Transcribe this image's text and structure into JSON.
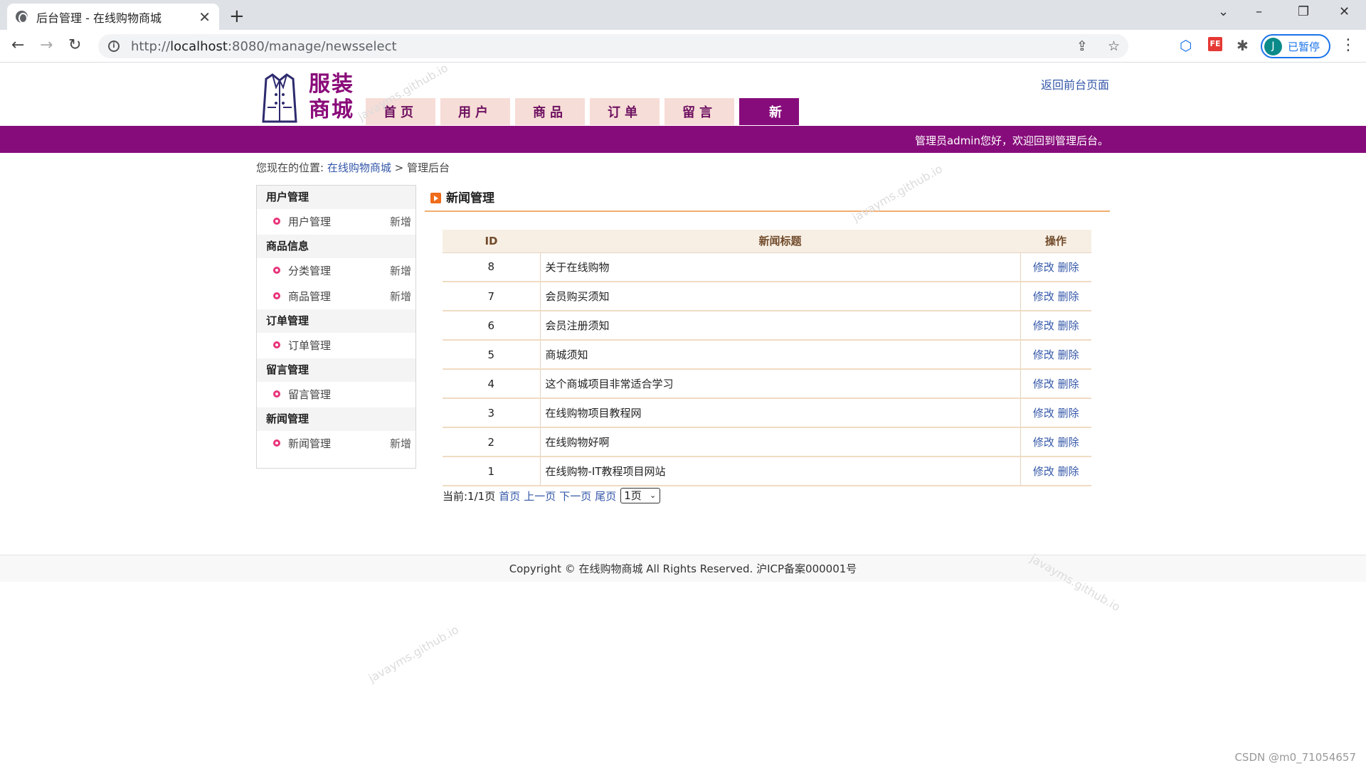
{
  "browser": {
    "tab_title": "后台管理 - 在线购物商城",
    "tab_close": "✕",
    "new_tab": "+",
    "url_proto": "http://",
    "url_host": "localhost",
    "url_rest": ":8080/manage/newsselect",
    "profile_initial": "J",
    "profile_label": "已暂停"
  },
  "header": {
    "logo_text": "服装商城",
    "back_link": "返回前台页面",
    "nav_tabs": [
      "首页",
      "用户",
      "商品",
      "订单",
      "留言",
      "新闻"
    ],
    "active_tab": "新闻",
    "welcome": "管理员admin您好，欢迎回到管理后台。"
  },
  "breadcrumb": {
    "prefix": "您现在的位置:",
    "link": "在线购物商城",
    "sep": ">",
    "current": "管理后台"
  },
  "sidebar": {
    "groups": [
      {
        "title": "用户管理",
        "items": [
          {
            "label": "用户管理",
            "add": "新增"
          }
        ]
      },
      {
        "title": "商品信息",
        "items": [
          {
            "label": "分类管理",
            "add": "新增"
          },
          {
            "label": "商品管理",
            "add": "新增"
          }
        ]
      },
      {
        "title": "订单管理",
        "items": [
          {
            "label": "订单管理",
            "add": ""
          }
        ]
      },
      {
        "title": "留言管理",
        "items": [
          {
            "label": "留言管理",
            "add": ""
          }
        ]
      },
      {
        "title": "新闻管理",
        "items": [
          {
            "label": "新闻管理",
            "add": "新增"
          }
        ]
      }
    ]
  },
  "main": {
    "section_title": "新闻管理",
    "columns": [
      "ID",
      "新闻标题",
      "操作"
    ],
    "edit_label": "修改",
    "delete_label": "删除",
    "rows": [
      {
        "id": "8",
        "title": "关于在线购物"
      },
      {
        "id": "7",
        "title": "会员购买须知"
      },
      {
        "id": "6",
        "title": "会员注册须知"
      },
      {
        "id": "5",
        "title": "商城须知"
      },
      {
        "id": "4",
        "title": "这个商城项目非常适合学习"
      },
      {
        "id": "3",
        "title": "在线购物项目教程网"
      },
      {
        "id": "2",
        "title": "在线购物好啊"
      },
      {
        "id": "1",
        "title": "在线购物-IT教程项目网站"
      }
    ],
    "pager": {
      "current": "当前:1/1页",
      "first": "首页",
      "prev": "上一页",
      "next": "下一页",
      "last": "尾页",
      "select_value": "1页"
    }
  },
  "footer": {
    "text": "Copyright © 在线购物商城 All Rights Reserved. 沪ICP备案000001号"
  },
  "watermark": "javayms.github.io",
  "csdn_mark": "CSDN @m0_71054657"
}
